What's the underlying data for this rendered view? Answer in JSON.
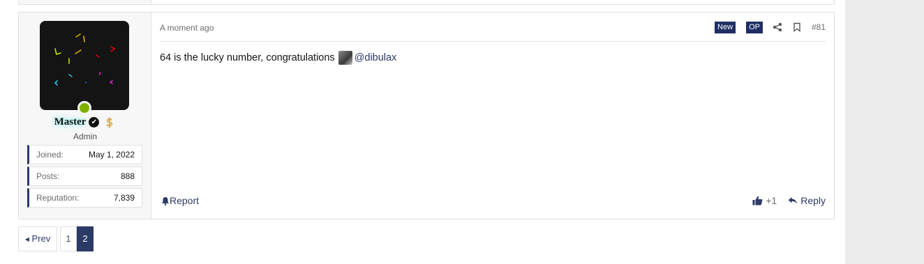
{
  "post": {
    "number": "#81",
    "timestamp": "A moment ago",
    "badges": {
      "new": "New",
      "op": "OP"
    },
    "content": {
      "text": "64 is the lucky number, congratulations",
      "mention": "@dibulax"
    },
    "actions": {
      "report": "Report",
      "like_count": "+1",
      "reply": "Reply"
    },
    "icons": [
      "share-icon",
      "bookmark-icon",
      "bell-icon",
      "thumbs-up-icon",
      "reply-arrow-icon"
    ]
  },
  "user": {
    "name": "Master",
    "title": "Admin",
    "online": true,
    "stats": [
      {
        "label": "Joined:",
        "value": "May 1, 2022"
      },
      {
        "label": "Posts:",
        "value": "888"
      },
      {
        "label": "Reputation:",
        "value": "7,839"
      }
    ]
  },
  "pagination": {
    "prev": "Prev",
    "pages": [
      "1",
      "2"
    ],
    "current": "2"
  },
  "colors": {
    "accent": "#2b3a67",
    "badge": "#1f2f63",
    "online": "#7fb000"
  }
}
